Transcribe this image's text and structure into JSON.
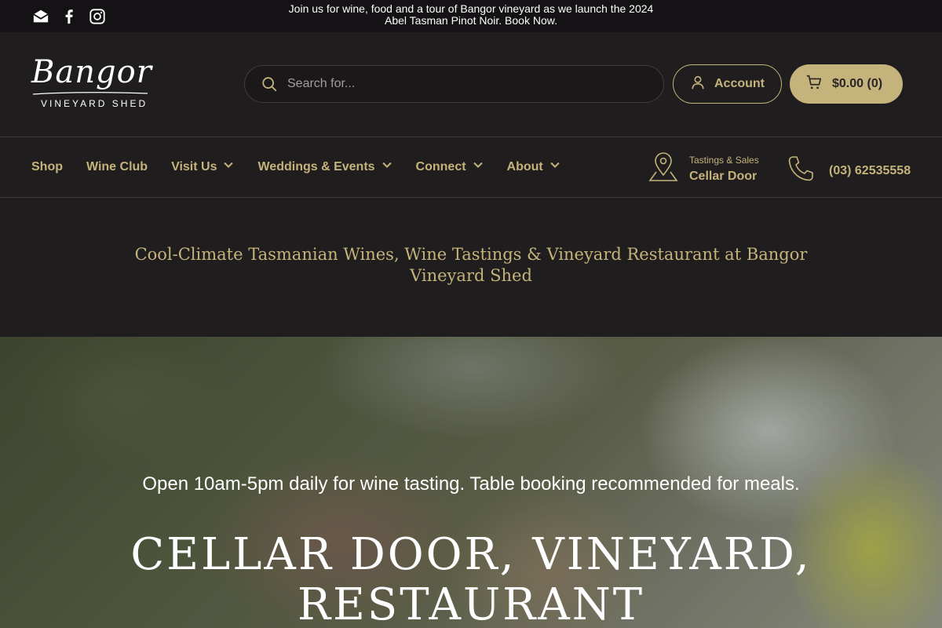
{
  "topbar": {
    "social_icons": [
      "envelope-icon",
      "facebook-icon",
      "instagram-icon"
    ],
    "announcement_line1": "Join us for wine, food and a tour of Bangor vineyard as we launch the 2024",
    "announcement_line2": "Abel Tasman Pinot Noir. Book Now."
  },
  "header": {
    "logo_script": "Bangor",
    "logo_sub": "VINEYARD SHED",
    "search_placeholder": "Search for...",
    "account_label": "Account",
    "cart_label": "$0.00 (0)"
  },
  "nav": {
    "items": [
      {
        "label": "Shop",
        "dropdown": false
      },
      {
        "label": "Wine Club",
        "dropdown": false
      },
      {
        "label": "Visit Us",
        "dropdown": true
      },
      {
        "label": "Weddings & Events",
        "dropdown": true
      },
      {
        "label": "Connect",
        "dropdown": true
      },
      {
        "label": "About",
        "dropdown": true
      }
    ],
    "cellar_small": "Tastings & Sales",
    "cellar_big": "Cellar Door",
    "phone": "(03) 62535558"
  },
  "tagline": "Cool-Climate Tasmanian Wines, Wine Tastings & Vineyard Restaurant at Bangor Vineyard Shed",
  "hero": {
    "subtitle": "Open 10am-5pm daily for wine tasting. Table booking recommended for meals.",
    "title": "CELLAR DOOR, VINEYARD, RESTAURANT"
  },
  "colors": {
    "accent": "#c4b37a",
    "background": "#201d1f",
    "topbar": "#141214"
  }
}
